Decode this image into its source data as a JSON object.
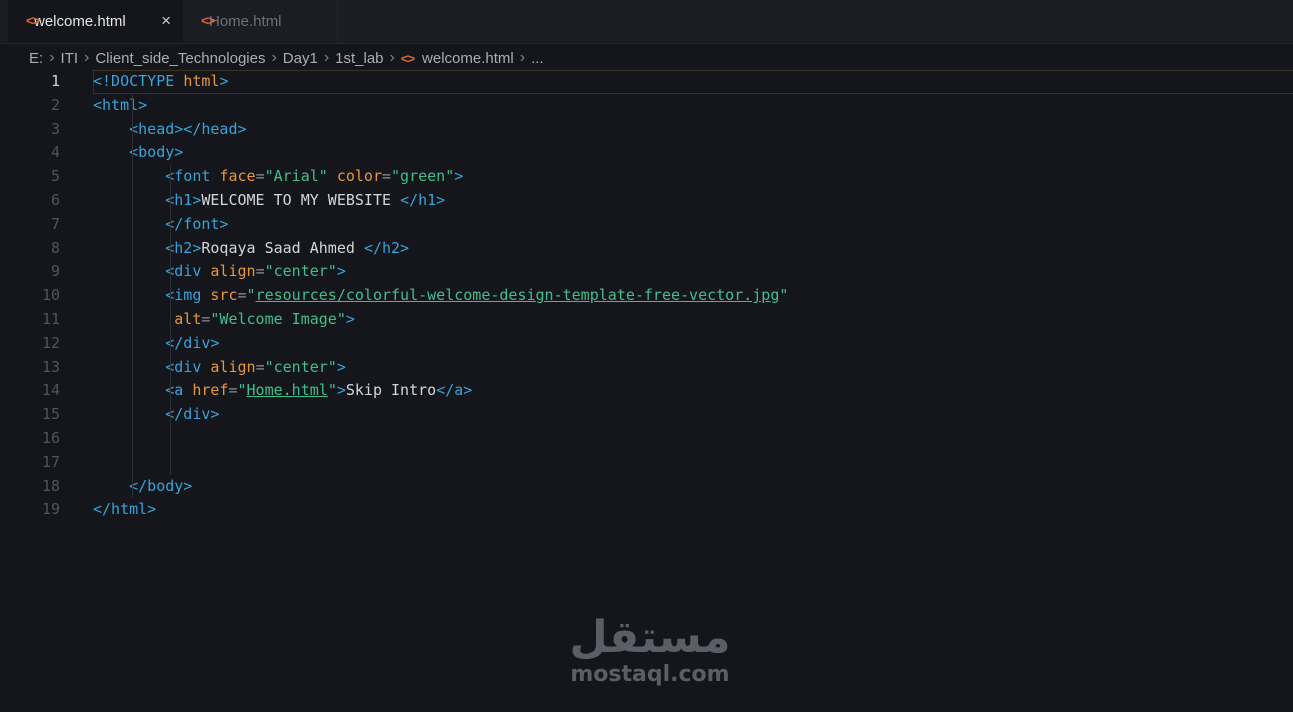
{
  "tabs": [
    {
      "label": "welcome.html",
      "active": true,
      "close_icon": "×"
    },
    {
      "label": "Home.html",
      "active": false
    }
  ],
  "file_icon_glyph": "<>",
  "breadcrumb": [
    "E:",
    "ITI",
    "Client_side_Technologies",
    "Day1",
    "1st_lab",
    "welcome.html",
    "..."
  ],
  "breadcrumb_sep": "›",
  "current_line": 1,
  "lines": [
    [
      [
        "t",
        "<!DOCTYPE "
      ],
      [
        "a",
        "html"
      ],
      [
        "t",
        ">"
      ]
    ],
    [
      [
        "t",
        "<html>"
      ]
    ],
    [
      [
        "x",
        "    "
      ],
      [
        "t",
        "<head></head>"
      ]
    ],
    [
      [
        "x",
        "    "
      ],
      [
        "t",
        "<body>"
      ]
    ],
    [
      [
        "x",
        "        "
      ],
      [
        "t",
        "<font "
      ],
      [
        "a",
        "face"
      ],
      [
        "e",
        "="
      ],
      [
        "s",
        "\"Arial\""
      ],
      [
        "x",
        " "
      ],
      [
        "a",
        "color"
      ],
      [
        "e",
        "="
      ],
      [
        "s",
        "\"green\""
      ],
      [
        "t",
        ">"
      ]
    ],
    [
      [
        "x",
        "        "
      ],
      [
        "t",
        "<h1>"
      ],
      [
        "x",
        "WELCOME TO MY WEBSITE "
      ],
      [
        "t",
        "</h1>"
      ]
    ],
    [
      [
        "x",
        "        "
      ],
      [
        "t",
        "</font>"
      ]
    ],
    [
      [
        "x",
        "        "
      ],
      [
        "t",
        "<h2>"
      ],
      [
        "x",
        "Roqaya Saad Ahmed "
      ],
      [
        "t",
        "</h2>"
      ]
    ],
    [
      [
        "x",
        "        "
      ],
      [
        "t",
        "<div "
      ],
      [
        "a",
        "align"
      ],
      [
        "e",
        "="
      ],
      [
        "s",
        "\"center\""
      ],
      [
        "t",
        ">"
      ]
    ],
    [
      [
        "x",
        "        "
      ],
      [
        "t",
        "<img "
      ],
      [
        "a",
        "src"
      ],
      [
        "e",
        "="
      ],
      [
        "s",
        "\""
      ],
      [
        "l",
        "resources/colorful-welcome-design-template-free-vector.jpg"
      ],
      [
        "s",
        "\""
      ]
    ],
    [
      [
        "x",
        "         "
      ],
      [
        "a",
        "alt"
      ],
      [
        "e",
        "="
      ],
      [
        "s",
        "\"Welcome Image\""
      ],
      [
        "t",
        ">"
      ]
    ],
    [
      [
        "x",
        "        "
      ],
      [
        "t",
        "</div>"
      ]
    ],
    [
      [
        "x",
        "        "
      ],
      [
        "t",
        "<div "
      ],
      [
        "a",
        "align"
      ],
      [
        "e",
        "="
      ],
      [
        "s",
        "\"center\""
      ],
      [
        "t",
        ">"
      ]
    ],
    [
      [
        "x",
        "        "
      ],
      [
        "t",
        "<a "
      ],
      [
        "a",
        "href"
      ],
      [
        "e",
        "="
      ],
      [
        "s",
        "\""
      ],
      [
        "l",
        "Home.html"
      ],
      [
        "s",
        "\""
      ],
      [
        "t",
        ">"
      ],
      [
        "x",
        "Skip Intro"
      ],
      [
        "t",
        "</a>"
      ]
    ],
    [
      [
        "x",
        "        "
      ],
      [
        "t",
        "</div>"
      ]
    ],
    [],
    [],
    [
      [
        "x",
        "    "
      ],
      [
        "t",
        "</body>"
      ]
    ],
    [
      [
        "t",
        "</html>"
      ]
    ]
  ],
  "watermark": {
    "arabic": "مستقل",
    "latin": "mostaql.com"
  },
  "colors": {
    "background": "#14161b",
    "tag": "#36a3d9",
    "attribute": "#e8963a",
    "string": "#3fbf8a",
    "text": "#d4d6db",
    "file_icon": "#e0692e"
  }
}
